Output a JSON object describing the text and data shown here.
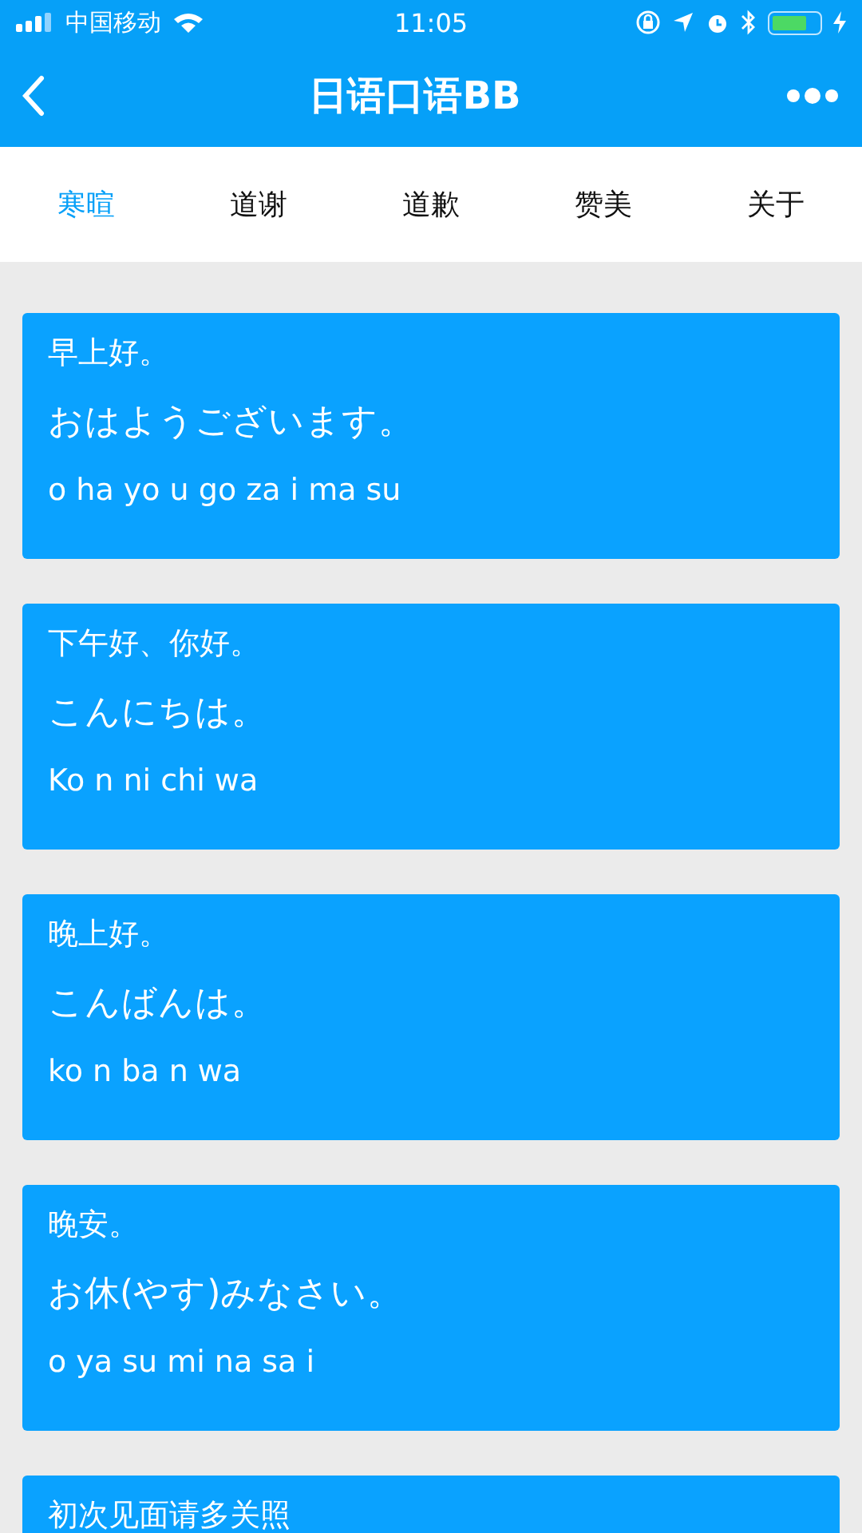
{
  "status_bar": {
    "carrier": "中国移动",
    "time": "11:05",
    "battery": {
      "level": 0.75
    }
  },
  "nav_bar": {
    "title": "日语口语BB"
  },
  "tabs": [
    {
      "label": "寒暄",
      "selected": true
    },
    {
      "label": "道谢",
      "selected": false
    },
    {
      "label": "道歉",
      "selected": false
    },
    {
      "label": "赞美",
      "selected": false
    },
    {
      "label": "关于",
      "selected": false
    }
  ],
  "phrases": [
    {
      "chinese": "早上好。",
      "japanese": "おはようございます。",
      "romaji": "o ha yo u go za i ma su"
    },
    {
      "chinese": "下午好、你好。",
      "japanese": "こんにちは。",
      "romaji": "Ko n ni chi wa"
    },
    {
      "chinese": "晚上好。",
      "japanese": "こんばんは。",
      "romaji": "ko n ba n wa"
    },
    {
      "chinese": "晚安。",
      "japanese": "お休(やす)みなさい。",
      "romaji": "o ya su mi na sa i"
    },
    {
      "chinese": "初次见面请多关照"
    }
  ]
}
